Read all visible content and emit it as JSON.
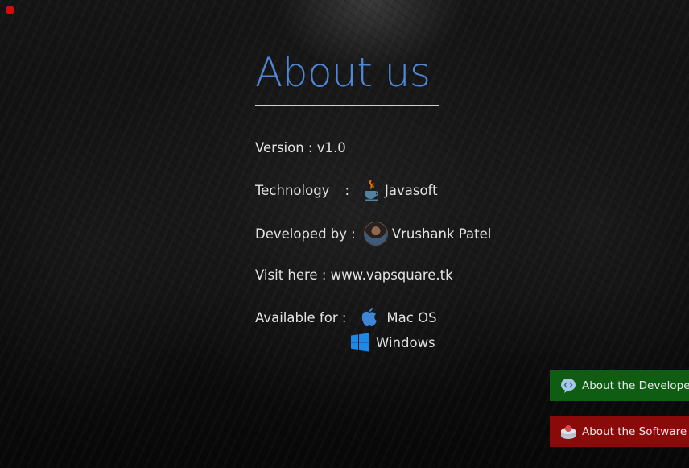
{
  "title": "About us",
  "rows": {
    "version": "Version : v1.0",
    "technology_label": "Technology",
    "technology_colon": ":",
    "technology_value": "Javasoft",
    "developed_label": "Developed by :",
    "developed_value": "Vrushank Patel",
    "visit": "Visit here : www.vapsquare.tk",
    "available_label": "Available for :",
    "available_items": [
      "Mac OS",
      "Windows"
    ]
  },
  "buttons": {
    "developer": "About the Developer",
    "software": "About the Software"
  },
  "icons": {
    "technology": "java-icon",
    "developer": "avatar",
    "mac": "apple-icon",
    "windows": "windows-icon",
    "about_developer": "code-bubble-icon",
    "about_software": "software-box-icon"
  },
  "colors": {
    "title": "#4f87d6",
    "close": "#d10e0e",
    "developer_button": "#0f5d12",
    "software_button": "#8a0a0a"
  }
}
